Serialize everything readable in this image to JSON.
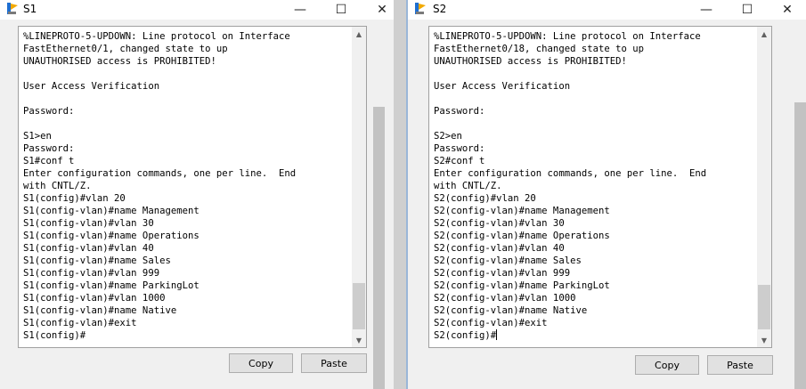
{
  "windows": [
    {
      "id": "s1",
      "title": "S1",
      "minimize_glyph": "—",
      "maximize_glyph": "☐",
      "close_glyph": "✕",
      "terminal_lines": [
        "%LINEPROTO-5-UPDOWN: Line protocol on Interface",
        "FastEthernet0/1, changed state to up",
        "UNAUTHORISED access is PROHIBITED!",
        "",
        "User Access Verification",
        "",
        "Password:",
        "",
        "S1>en",
        "Password:",
        "S1#conf t",
        "Enter configuration commands, one per line.  End",
        "with CNTL/Z.",
        "S1(config)#vlan 20",
        "S1(config-vlan)#name Management",
        "S1(config-vlan)#vlan 30",
        "S1(config-vlan)#name Operations",
        "S1(config-vlan)#vlan 40",
        "S1(config-vlan)#name Sales",
        "S1(config-vlan)#vlan 999",
        "S1(config-vlan)#name ParkingLot",
        "S1(config-vlan)#vlan 1000",
        "S1(config-vlan)#name Native",
        "S1(config-vlan)#exit",
        "S1(config)#"
      ],
      "copy_label": "Copy",
      "paste_label": "Paste"
    },
    {
      "id": "s2",
      "title": "S2",
      "minimize_glyph": "—",
      "maximize_glyph": "☐",
      "close_glyph": "✕",
      "terminal_lines": [
        "%LINEPROTO-5-UPDOWN: Line protocol on Interface",
        "FastEthernet0/18, changed state to up",
        "UNAUTHORISED access is PROHIBITED!",
        "",
        "User Access Verification",
        "",
        "Password:",
        "",
        "S2>en",
        "Password:",
        "S2#conf t",
        "Enter configuration commands, one per line.  End",
        "with CNTL/Z.",
        "S2(config)#vlan 20",
        "S2(config-vlan)#name Management",
        "S2(config-vlan)#vlan 30",
        "S2(config-vlan)#name Operations",
        "S2(config-vlan)#vlan 40",
        "S2(config-vlan)#name Sales",
        "S2(config-vlan)#vlan 999",
        "S2(config-vlan)#name ParkingLot",
        "S2(config-vlan)#vlan 1000",
        "S2(config-vlan)#name Native",
        "S2(config-vlan)#exit",
        "S2(config)#"
      ],
      "copy_label": "Copy",
      "paste_label": "Paste"
    }
  ],
  "scroll_up_glyph": "▲",
  "scroll_down_glyph": "▼",
  "icons": {
    "app": "packet-tracer-icon",
    "minimize": "minimize-icon",
    "maximize": "maximize-icon",
    "close": "close-icon"
  }
}
